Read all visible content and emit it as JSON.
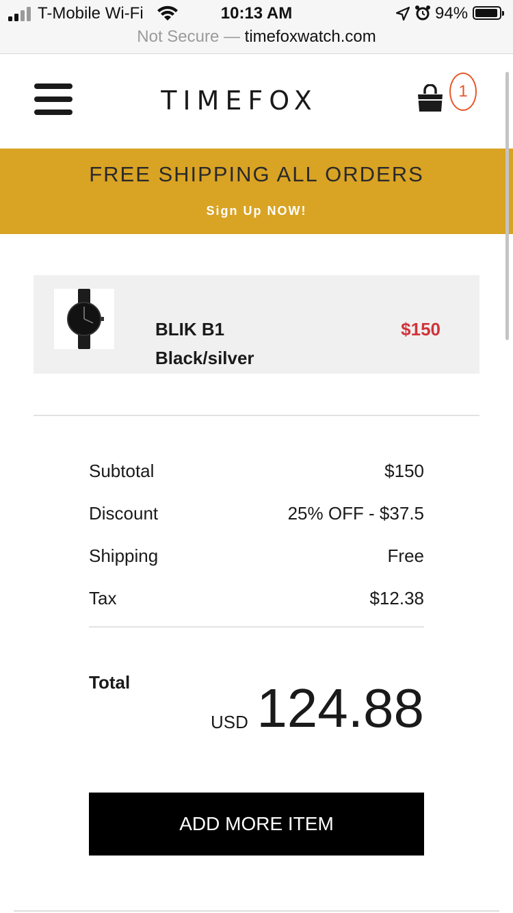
{
  "status_bar": {
    "carrier": "T-Mobile Wi-Fi",
    "time": "10:13 AM",
    "battery_percent": "94%",
    "battery_level": 0.94,
    "url_secure_text": "Not Secure —",
    "url_domain": "timefoxwatch.com"
  },
  "header": {
    "logo": "TIMEFOX",
    "cart_count": "1",
    "icons": [
      "menu-icon",
      "shopping-bag-icon"
    ]
  },
  "promo": {
    "title": "FREE SHIPPING ALL ORDERS",
    "link": "Sign Up NOW!"
  },
  "cart": {
    "items": [
      {
        "name": "BLIK B1",
        "variant": "Black/silver",
        "price": "$150",
        "image_icon": "watch-icon"
      }
    ]
  },
  "summary": {
    "rows": [
      {
        "label": "Subtotal",
        "value": "$150"
      },
      {
        "label": "Discount",
        "value": "25% OFF - $37.5"
      },
      {
        "label": "Shipping",
        "value": "Free"
      },
      {
        "label": "Tax",
        "value": "$12.38"
      }
    ],
    "total_label": "Total",
    "currency": "USD",
    "total_amount": "124.88"
  },
  "actions": {
    "add_more": "ADD MORE ITEM"
  },
  "colors": {
    "promo_bg": "#d9a324",
    "price_red": "#d0333a",
    "badge_orange": "#e8572a",
    "button_bg": "#000000"
  }
}
